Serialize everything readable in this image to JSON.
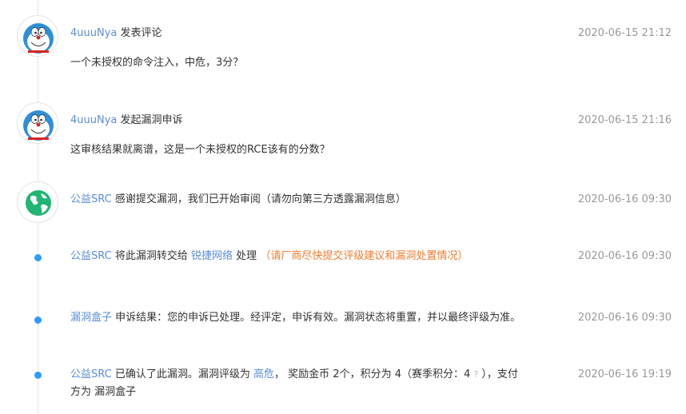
{
  "entries": [
    {
      "user": "4uuuNya",
      "action": "发表评论",
      "time": "2020-06-15 21:12",
      "text": "一个未授权的命令注入，中危，3分？"
    },
    {
      "user": "4uuuNya",
      "action": "发起漏洞申诉",
      "time": "2020-06-15 21:16",
      "text": "这审核结果就离谱，这是一个未授权的RCE该有的分数？"
    },
    {
      "user": "公益SRC",
      "action": "感谢提交漏洞，我们已开始审阅（请勿向第三方透露漏洞信息）",
      "time": "2020-06-16 09:30"
    },
    {
      "user": "公益SRC",
      "pre": "将此漏洞转交给",
      "org": "锐捷网络",
      "post": "处理",
      "note": "（请厂商尽快提交评级建议和漏洞处置情况）",
      "time": "2020-06-16 09:30"
    },
    {
      "user": "漏洞盒子",
      "action": "申诉结果：您的申诉已处理。经评定，申诉有效。漏洞状态将重置，并以最终评级为准。",
      "time": "2020-06-16 09:30"
    },
    {
      "user": "公益SRC",
      "pre": "已确认了此漏洞。漏洞评级为",
      "level": "高危",
      "mid": "， 奖励金币 2个，积分为 4（赛季积分：4",
      "help": "?",
      "post": "），支付",
      "line2_pre": "方为",
      "payer": "漏洞盒子",
      "time": "2020-06-16 19:19"
    }
  ],
  "colors": {
    "link": "#5b8dd6",
    "orange": "#ee7d31",
    "dot": "#2e9bff",
    "time": "#999999"
  },
  "icons": [
    "doraemon-avatar-icon",
    "globe-icon"
  ]
}
